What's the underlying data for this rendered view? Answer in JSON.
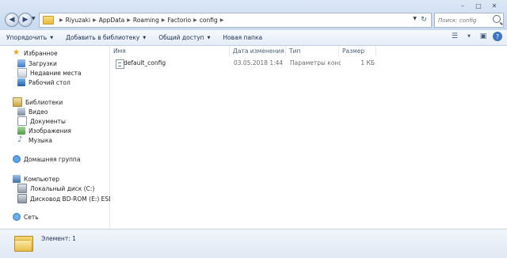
{
  "window": {
    "caption": {
      "minimize": "–",
      "maximize": "□",
      "close": "✕"
    }
  },
  "address": {
    "crumbs": [
      "Riyuzaki",
      "AppData",
      "Roaming",
      "Factorio",
      "config"
    ],
    "search_placeholder": "Поиск: config"
  },
  "toolbar": {
    "organize": "Упорядочить",
    "add_to_library": "Добавить в библиотеку",
    "share": "Общий доступ",
    "new_folder": "Новая папка"
  },
  "nav": {
    "favorites": "Избранное",
    "downloads": "Загрузки",
    "recent": "Недавние места",
    "desktop": "Рабочий стол",
    "libraries": "Библиотеки",
    "video": "Видео",
    "documents": "Документы",
    "pictures": "Изображения",
    "music": "Музыка",
    "homegroup": "Домашняя группа",
    "computer": "Компьютер",
    "local_disk": "Локальный диск (C:)",
    "dvd_drive": "Дисковод BD-ROM (E:) ESD-ISO",
    "network": "Сеть"
  },
  "columns": {
    "name": "Имя",
    "date_modified": "Дата изменения",
    "type": "Тип",
    "size": "Размер"
  },
  "files": [
    {
      "name": "default_config",
      "date": "03.05.2018 1:44",
      "type": "Параметры конф...",
      "size": "1 КБ"
    }
  ],
  "details": {
    "count_label": "Элемент: 1"
  }
}
